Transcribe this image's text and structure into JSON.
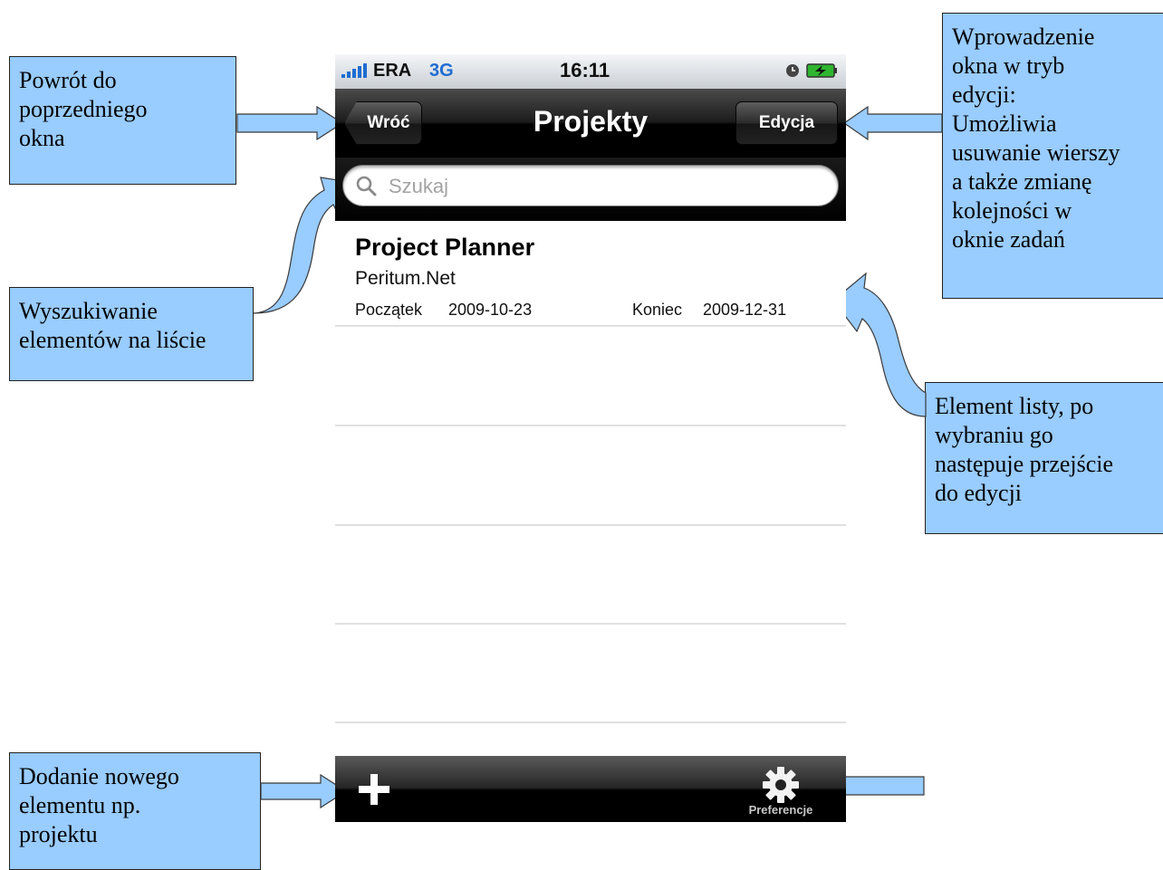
{
  "callouts": {
    "back": "Powrót do\npoprzedniego\nokna",
    "search": "Wyszukiwanie\nelementów na liście",
    "edit": "Wprowadzenie\nokna w tryb\nedycji:\nUmożliwia\nusuwanie wierszy\na także zmianę\nkolejności w\noknie zadań",
    "item": "Element listy, po\nwybraniu go\nnastępuje przejście\ndo edycji",
    "add": "Dodanie nowego\nelementu np.\nprojektu"
  },
  "status_bar": {
    "carrier": "ERA",
    "network": "3G",
    "time": "16:11"
  },
  "nav_bar": {
    "back_label": "Wróć",
    "title": "Projekty",
    "edit_label": "Edycja"
  },
  "search": {
    "placeholder": "Szukaj"
  },
  "list": {
    "items": [
      {
        "name": "Project Planner",
        "company": "Peritum.Net",
        "start_label": "Początek",
        "start_date": "2009-10-23",
        "end_label": "Koniec",
        "end_date": "2009-12-31"
      }
    ]
  },
  "toolbar": {
    "add_icon": "plus-icon",
    "settings_icon": "gear-icon",
    "settings_label": "Preferencje"
  },
  "colors": {
    "callout_fill": "#99ccff",
    "arrow_fill": "#99ccff",
    "network_blue": "#1f6dd1"
  }
}
